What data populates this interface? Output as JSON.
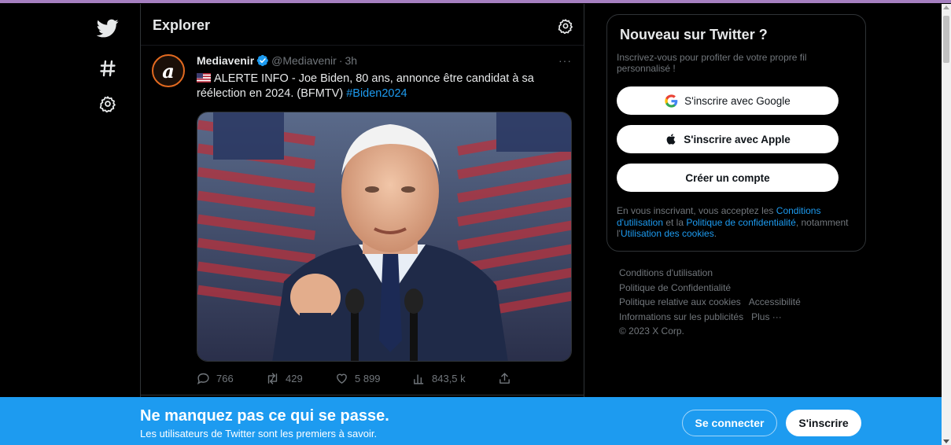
{
  "nav": {
    "icons": [
      "twitter-logo-icon",
      "hashtag-icon",
      "settings-gear-icon"
    ]
  },
  "header": {
    "title": "Explorer"
  },
  "tweet": {
    "author_name": "Mediavenir",
    "author_handle": "@Mediavenir",
    "separator": "·",
    "time": "3h",
    "more": "···",
    "text_main": "ALERTE INFO - Joe Biden, 80 ans, annonce être candidat à sa réélection en 2024. (BFMTV)",
    "hashtag": "#Biden2024",
    "stats": {
      "replies": "766",
      "retweets": "429",
      "likes": "5 899",
      "views": "843,5 k"
    }
  },
  "signup_card": {
    "title": "Nouveau sur Twitter ?",
    "subtitle": "Inscrivez-vous pour profiter de votre propre fil personnalisé !",
    "google_label": "S'inscrire avec Google",
    "apple_label": "S'inscrire avec Apple",
    "create_label": "Créer un compte",
    "legal_prefix": "En vous inscrivant, vous acceptez les",
    "legal_terms": "Conditions d'utilisation",
    "legal_and": "et la",
    "legal_privacy": "Politique de confidentialité",
    "legal_mid": ", notamment l'",
    "legal_cookies": "Utilisation des cookies",
    "legal_end": "."
  },
  "footer": {
    "terms": "Conditions d'utilisation",
    "privacy": "Politique de Confidentialité",
    "cookies": "Politique relative aux cookies",
    "accessibility": "Accessibilité",
    "ads": "Informations sur les publicités",
    "more": "Plus ···",
    "copyright": "© 2023 X Corp."
  },
  "banner": {
    "title": "Ne manquez pas ce qui se passe.",
    "subtitle": "Les utilisateurs de Twitter sont les premiers à savoir.",
    "login_label": "Se connecter",
    "signup_label": "S'inscrire"
  },
  "colors": {
    "accent": "#1d9bf0",
    "background": "#000000",
    "muted": "#71767b"
  }
}
